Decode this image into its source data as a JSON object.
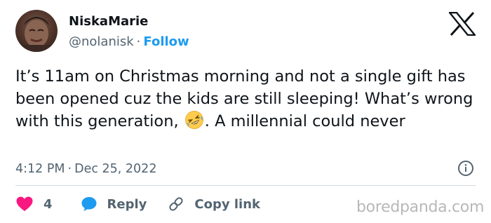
{
  "author": {
    "name": "NiskaMarie",
    "handle": "@nolanisk",
    "separator": "·",
    "follow_label": "Follow"
  },
  "tweet": {
    "text_part1": "It’s 11am on Christmas morning and not a single gift has been opened cuz the kids are still sleeping! What’s wrong with this generation,",
    "emoji": "rolling-on-floor-laughing-emoji",
    "text_part2": ". A millennial could never"
  },
  "meta": {
    "time": "4:12 PM",
    "separator": "·",
    "date": "Dec 25, 2022"
  },
  "actions": {
    "like_count": "4",
    "reply_label": "Reply",
    "copy_link_label": "Copy link"
  },
  "watermark": "boredpanda.com",
  "icons": {
    "platform": "x-logo-icon",
    "info": "info-icon",
    "like": "heart-icon",
    "reply": "speech-bubble-icon",
    "copy": "link-icon"
  },
  "colors": {
    "text": "#0f1419",
    "secondary": "#536471",
    "accent": "#1d9bf0",
    "like": "#f91880",
    "divider": "#cfd9de",
    "watermark": "#b8b8b8"
  }
}
